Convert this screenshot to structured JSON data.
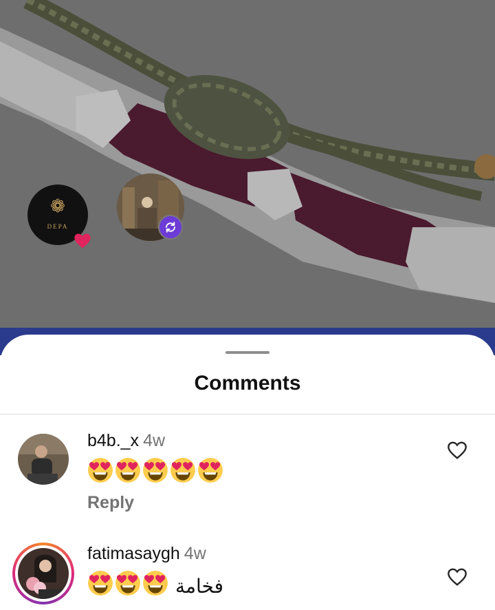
{
  "post": {
    "story_brand_text": "DEPA"
  },
  "sheet": {
    "title": "Comments"
  },
  "comments": [
    {
      "username": "b4b._x",
      "time": "4w",
      "text": "",
      "emoji": [
        "heart-eyes",
        "heart-eyes",
        "heart-eyes",
        "heart-eyes",
        "heart-eyes"
      ],
      "reply_label": "Reply"
    },
    {
      "username": "fatimasaygh",
      "time": "4w",
      "text": "فخامة",
      "emoji": [
        "heart-eyes",
        "heart-eyes",
        "heart-eyes"
      ]
    }
  ],
  "icons": {
    "like": "heart-outline-icon",
    "repost": "repost-icon",
    "story_heart": "heart-icon"
  },
  "colors": {
    "repost_badge": "#6d3bd6",
    "story_heart": "#e0245e",
    "header_strip": "#2a3a8c"
  }
}
